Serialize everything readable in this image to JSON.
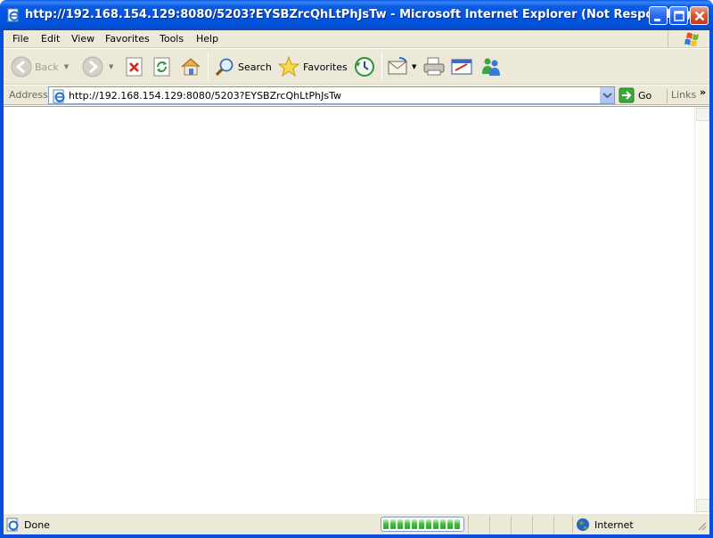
{
  "window": {
    "title": "http://192.168.154.129:8080/5203?EYSBZrcQhLtPhJsTw - Microsoft Internet Explorer (Not Responding)"
  },
  "menu": {
    "items": [
      "File",
      "Edit",
      "View",
      "Favorites",
      "Tools",
      "Help"
    ]
  },
  "toolbar": {
    "back_label": "Back",
    "search_label": "Search",
    "favorites_label": "Favorites"
  },
  "address": {
    "label": "Address",
    "url": "http://192.168.154.129:8080/5203?EYSBZrcQhLtPhJsTw",
    "go_label": "Go",
    "links_label": "Links"
  },
  "status": {
    "text": "Done",
    "progress": 1.0,
    "zone": "Internet"
  },
  "colors": {
    "titlebar": "#0054e3",
    "chrome": "#ece9d8",
    "progress_fill": "#3ac13a"
  }
}
